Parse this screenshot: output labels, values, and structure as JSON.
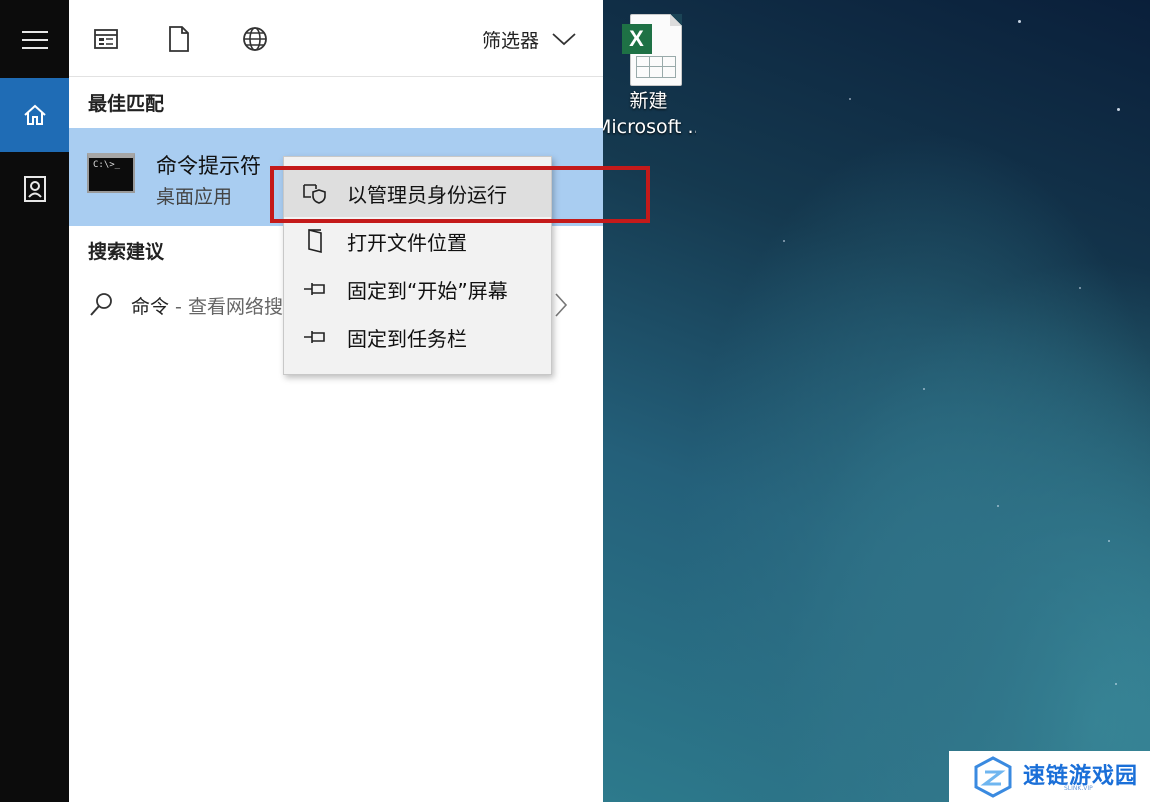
{
  "toolbar": {
    "icons": [
      "apps-icon",
      "document-icon",
      "web-icon"
    ],
    "filter_label": "筛选器"
  },
  "best_match": {
    "heading": "最佳匹配",
    "title": "命令提示符",
    "subtitle": "桌面应用"
  },
  "suggestions": {
    "heading": "搜索建议",
    "items": [
      {
        "query": "命令",
        "hint": " - 查看网络搜"
      }
    ]
  },
  "context_menu": {
    "items": [
      {
        "label": "以管理员身份运行",
        "icon": "shield-icon",
        "highlighted": true
      },
      {
        "label": "打开文件位置",
        "icon": "folder-location-icon"
      },
      {
        "label": "固定到“开始”屏幕",
        "icon": "pin-icon"
      },
      {
        "label": "固定到任务栏",
        "icon": "pin-icon"
      }
    ]
  },
  "desktop_icon": {
    "label_line1": "新建",
    "label_line2": "Microsoft ...",
    "badge": "X"
  },
  "watermark": {
    "text": "速链游戏园",
    "sub": "SLINK.VIP"
  },
  "colors": {
    "accent": "#1f6cb5",
    "selection": "#a9cdf1",
    "highlight_box": "#c41a1a",
    "excel_green": "#1e7145"
  }
}
